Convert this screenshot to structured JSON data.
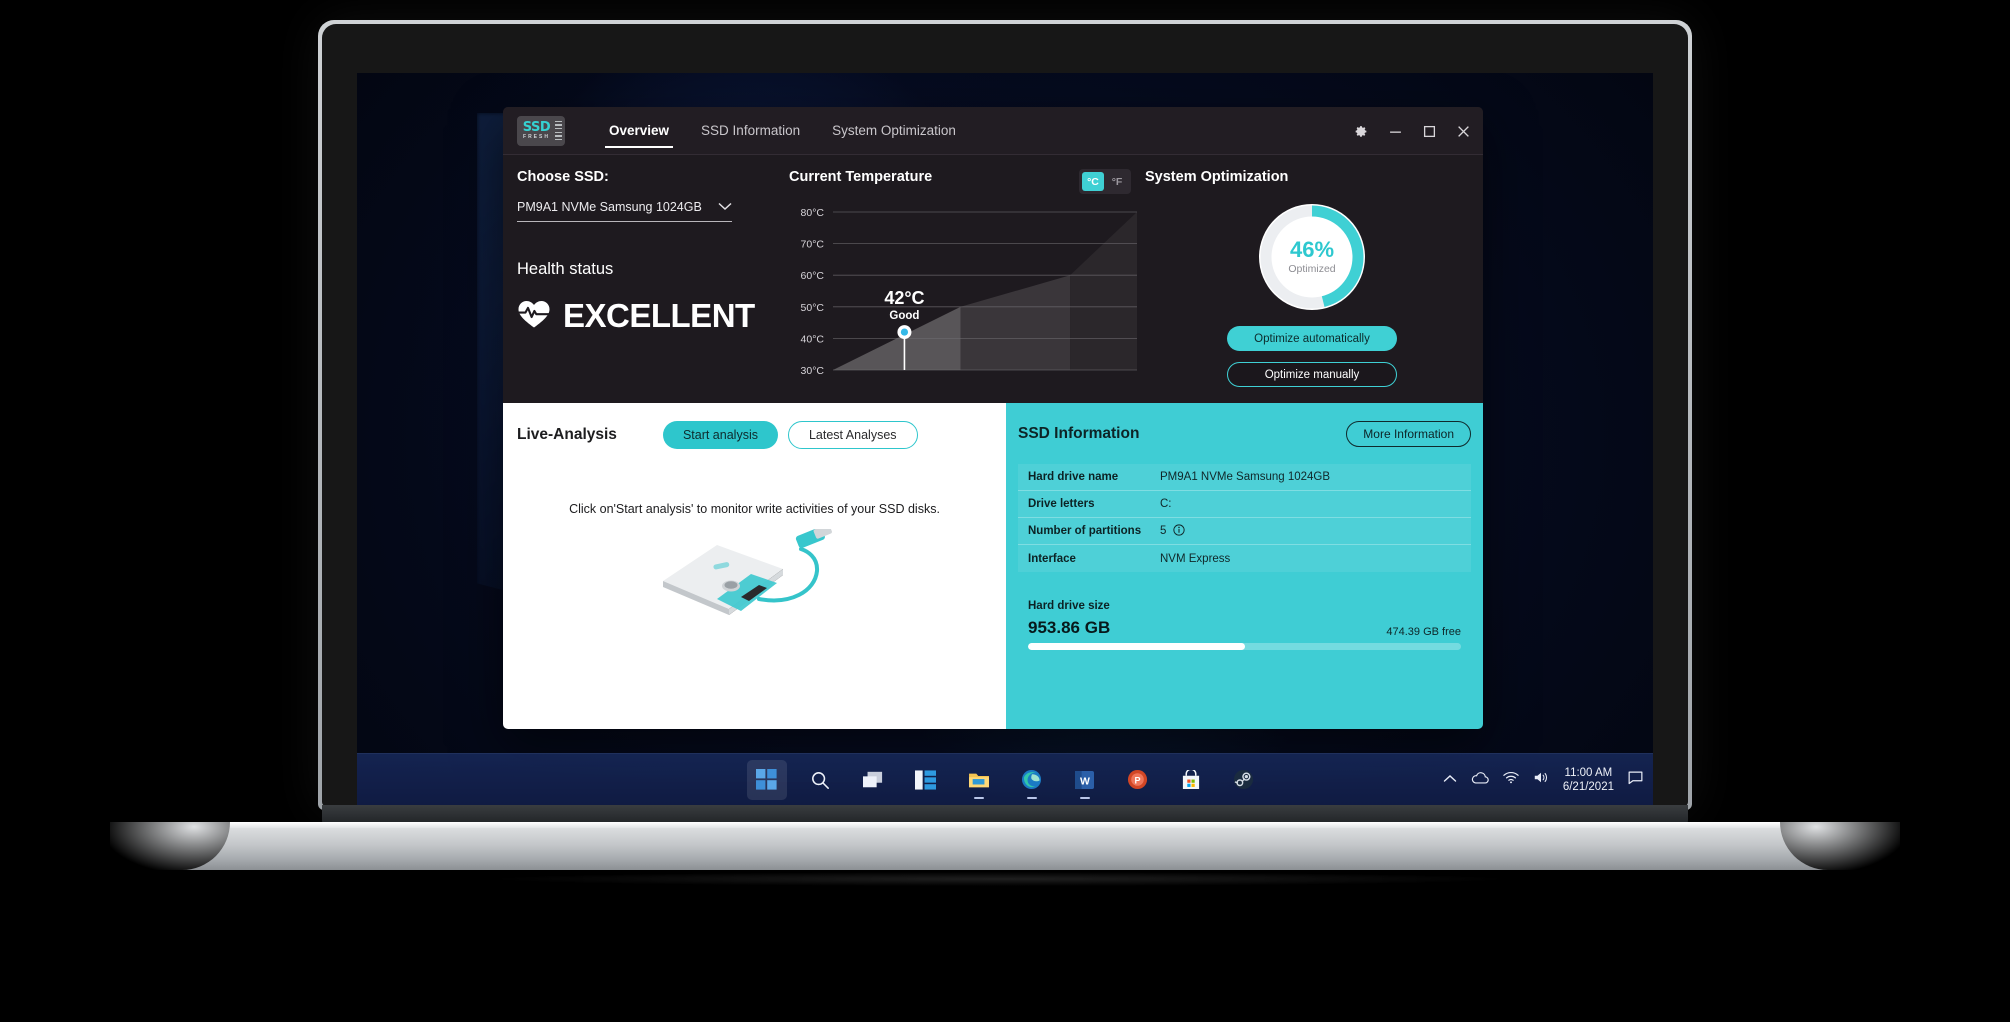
{
  "app": {
    "logo": {
      "primary": "SSD",
      "secondary": "FRESH"
    },
    "tabs": [
      {
        "label": "Overview",
        "active": true
      },
      {
        "label": "SSD Information",
        "active": false
      },
      {
        "label": "System Optimization",
        "active": false
      }
    ],
    "window_controls": [
      "settings-gear",
      "minimize",
      "maximize",
      "close"
    ]
  },
  "choose_ssd": {
    "label": "Choose SSD:",
    "selected": "PM9A1 NVMe Samsung 1024GB"
  },
  "health": {
    "title": "Health status",
    "value": "EXCELLENT"
  },
  "temperature": {
    "title": "Current Temperature",
    "unit_celsius": "°C",
    "unit_fahrenheit": "°F",
    "active_unit": "°C",
    "current": "42°C",
    "rating": "Good"
  },
  "chart_data": {
    "type": "area",
    "title": "Current Temperature",
    "ylabel": "",
    "xlabel": "",
    "ylim": [
      30,
      80
    ],
    "grid": true,
    "tick_labels": [
      "30°C",
      "40°C",
      "50°C",
      "60°C",
      "70°C",
      "80°C"
    ],
    "ticks": [
      30,
      40,
      50,
      60,
      70,
      80
    ],
    "marker": {
      "value": 42,
      "label": "42°C",
      "rating": "Good",
      "x_fraction": 0.235
    },
    "bands": [
      {
        "x_start": 0.0,
        "x_end": 0.42,
        "top_value": 50,
        "shade": "#585558"
      },
      {
        "x_start": 0.42,
        "x_end": 0.78,
        "top_value": 60,
        "shade": "#3a363a"
      },
      {
        "x_start": 0.78,
        "x_end": 1.0,
        "top_value": 80,
        "shade": "#2b272b"
      }
    ]
  },
  "optimization": {
    "title": "System Optimization",
    "percent": "46%",
    "percent_value": 46,
    "sub": "Optimized",
    "auto_button": "Optimize automatically",
    "manual_button": "Optimize manually",
    "accent": "#3fd0d4"
  },
  "live_analysis": {
    "title": "Live-Analysis",
    "start_button": "Start analysis",
    "latest_button": "Latest Analyses",
    "message": "Click on'Start analysis' to monitor write activities of your SSD disks."
  },
  "ssd_information": {
    "title": "SSD Information",
    "more_button": "More Information",
    "rows": [
      {
        "key": "Hard drive name",
        "value": "PM9A1 NVMe Samsung 1024GB",
        "info_icon": false
      },
      {
        "key": "Drive letters",
        "value": "C:",
        "info_icon": false
      },
      {
        "key": "Number of partitions",
        "value": "5",
        "info_icon": true
      },
      {
        "key": "Interface",
        "value": "NVM Express",
        "info_icon": false
      }
    ],
    "size_label": "Hard drive size",
    "size_total": "953.86 GB",
    "size_free": "474.39 GB free",
    "used_percent": 50
  },
  "taskbar": {
    "items": [
      "start-icon",
      "search-icon",
      "task-view-icon",
      "widgets-icon",
      "file-explorer-icon",
      "edge-icon",
      "word-icon",
      "powerpoint-icon",
      "microsoft-store-icon",
      "steam-icon"
    ],
    "tray": [
      "show-hidden-icons-icon",
      "onedrive-icon",
      "wifi-icon",
      "volume-icon"
    ],
    "time": "11:00 AM",
    "date": "6/21/2021",
    "notification": "notification-center-icon"
  }
}
